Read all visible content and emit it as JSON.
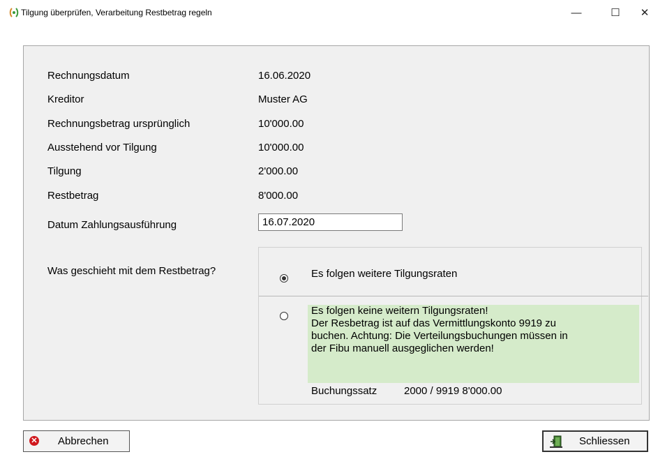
{
  "window": {
    "title": "Tilgung überprüfen, Verarbeitung Restbetrag regeln",
    "min_glyph": "—",
    "max_glyph": "☐",
    "close_glyph": "✕"
  },
  "fields": [
    {
      "label": "Rechnungsdatum",
      "value": "16.06.2020"
    },
    {
      "label": "Kreditor",
      "value": "Muster AG"
    },
    {
      "label": "Rechnungsbetrag ursprünglich",
      "value": "10'000.00"
    },
    {
      "label": "Ausstehend vor Tilgung",
      "value": "10'000.00"
    },
    {
      "label": "Tilgung",
      "value": "2'000.00"
    },
    {
      "label": "Restbetrag",
      "value": "8'000.00"
    }
  ],
  "payment_date": {
    "label": "Datum Zahlungsausführung",
    "value": "16.07.2020"
  },
  "question": "Was geschieht mit dem Restbetrag?",
  "options": {
    "option1": {
      "label": "Es folgen weitere Tilgungsraten",
      "selected": true
    },
    "option2": {
      "text": "Es folgen keine weitern Tilgungsraten!\nDer Resbetrag ist auf das Vermittlungskonto 9919 zu\nbuchen. Achtung: Die Verteilungsbuchungen müssen in\nder Fibu manuell ausgeglichen werden!",
      "selected": false,
      "highlight_color": "#d5ebca"
    },
    "booking": {
      "label": "Buchungssatz",
      "value": "2000 / 9919 8'000.00"
    }
  },
  "buttons": {
    "cancel": "Abbrechen",
    "close": "Schliessen"
  },
  "icons": {
    "app": "app-icon",
    "cancel": "cancel-x-icon",
    "close": "exit-door-icon"
  }
}
